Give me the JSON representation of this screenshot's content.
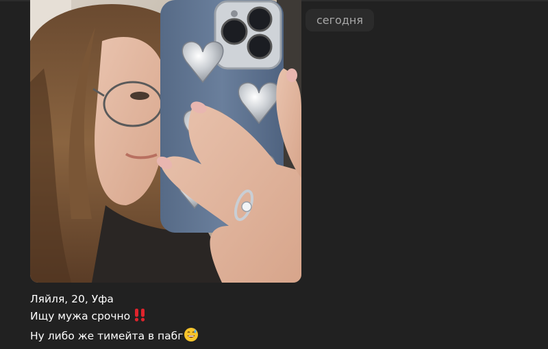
{
  "date_divider": {
    "label": "сегодня"
  },
  "message": {
    "photo_alt": "mirror-selfie-photo",
    "caption_lines": [
      "Ляйля, 20, Уфа",
      "Ищу мужа срочно",
      "Ну либо же тимейта в пабг"
    ],
    "emojis": [
      "double-exclamation-emoji",
      "grinning-sweat-emoji"
    ]
  },
  "colors": {
    "background": "#212121",
    "date_pill_bg": "#2b2b2b",
    "date_pill_text": "#a8a8a8",
    "caption_text": "#ffffff",
    "phone_case": "#5e7290"
  }
}
